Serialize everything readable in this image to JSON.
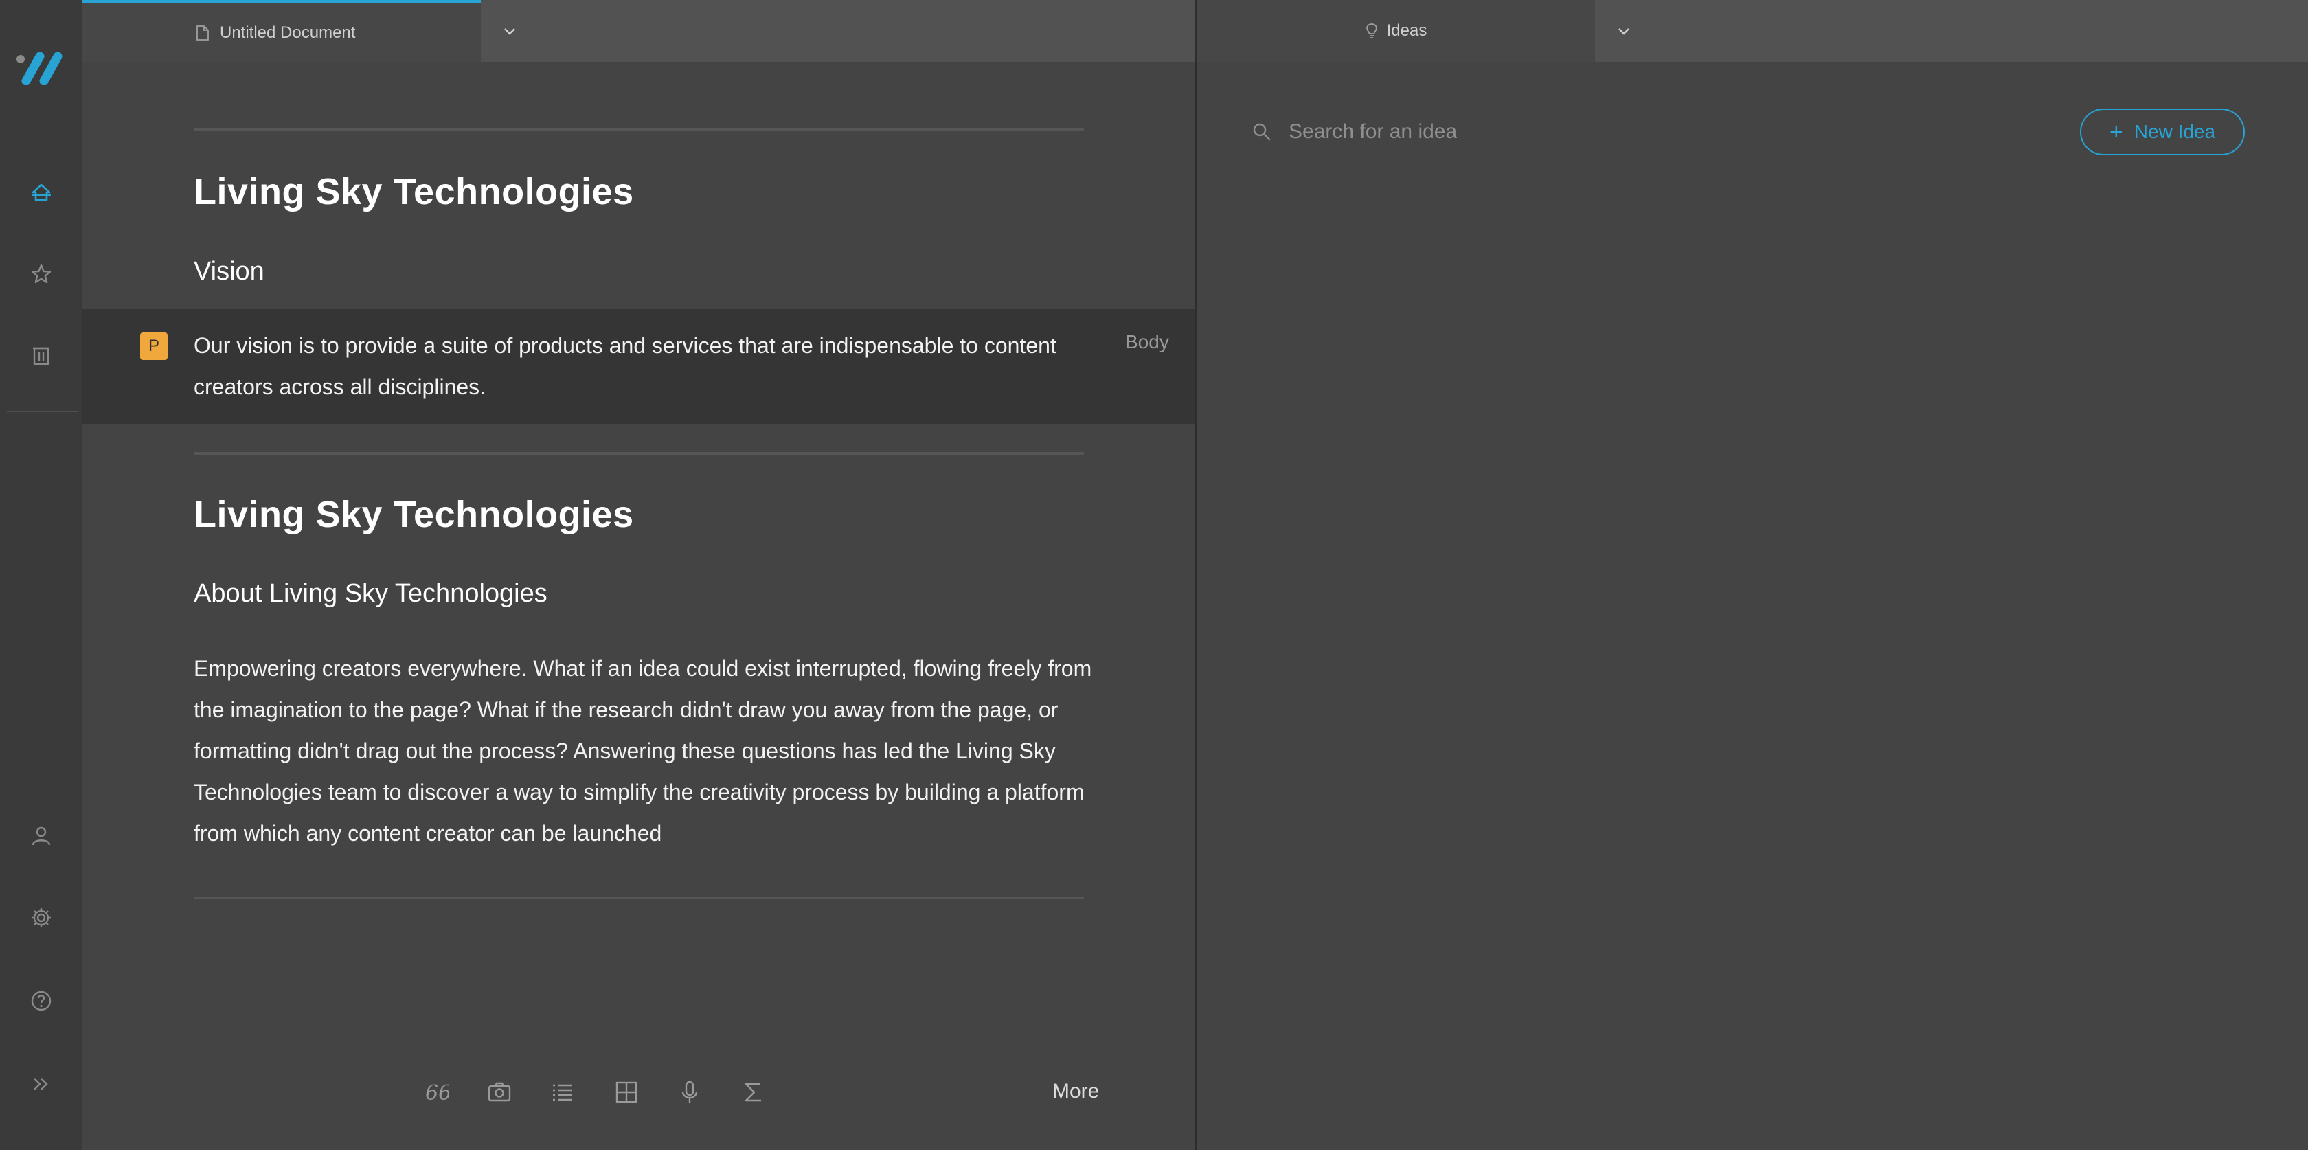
{
  "colors": {
    "accent": "#27a3d4",
    "badge": "#f0a83c",
    "rail": "#3a3a3a",
    "editor_bg": "#444444",
    "active_block": "#353535"
  },
  "rail": {
    "logo": "app-logo",
    "top_items": [
      {
        "name": "home",
        "icon": "home-icon"
      },
      {
        "name": "favorites",
        "icon": "star-icon"
      },
      {
        "name": "trash",
        "icon": "trash-icon"
      }
    ],
    "bottom_items": [
      {
        "name": "account",
        "icon": "user-icon"
      },
      {
        "name": "settings",
        "icon": "gear-icon"
      },
      {
        "name": "help",
        "icon": "help-icon"
      },
      {
        "name": "expand",
        "icon": "double-chevron-right-icon"
      }
    ]
  },
  "editor": {
    "tab": {
      "label": "Untitled Document",
      "icon": "document-icon"
    },
    "sections": [
      {
        "title": "Living Sky Technologies",
        "subtitle": "Vision",
        "body": "Our vision is to provide a suite of products and services that are indispensable to content creators across all disciplines.",
        "badge": "P",
        "style_label": "Body"
      },
      {
        "title": "Living Sky Technologies",
        "subtitle": "About Living Sky Technologies",
        "body": "Empowering creators everywhere. What if an idea could exist interrupted, flowing freely from the imagination to the page? What if the research didn't draw you away from the page, or formatting didn't drag out the process? Answering these questions has led the Living Sky Technologies team to discover a way to simplify the creativity process by building a platform from which any content creator can be launched"
      }
    ],
    "toolbar": {
      "tools": [
        "quote-icon",
        "camera-icon",
        "list-icon",
        "table-icon",
        "microphone-icon",
        "sigma-icon"
      ],
      "more_label": "More"
    }
  },
  "ideas": {
    "tab": {
      "label": "Ideas",
      "icon": "lightbulb-icon"
    },
    "search": {
      "placeholder": "Search for an idea",
      "value": ""
    },
    "new_button": {
      "label": "New Idea"
    }
  }
}
